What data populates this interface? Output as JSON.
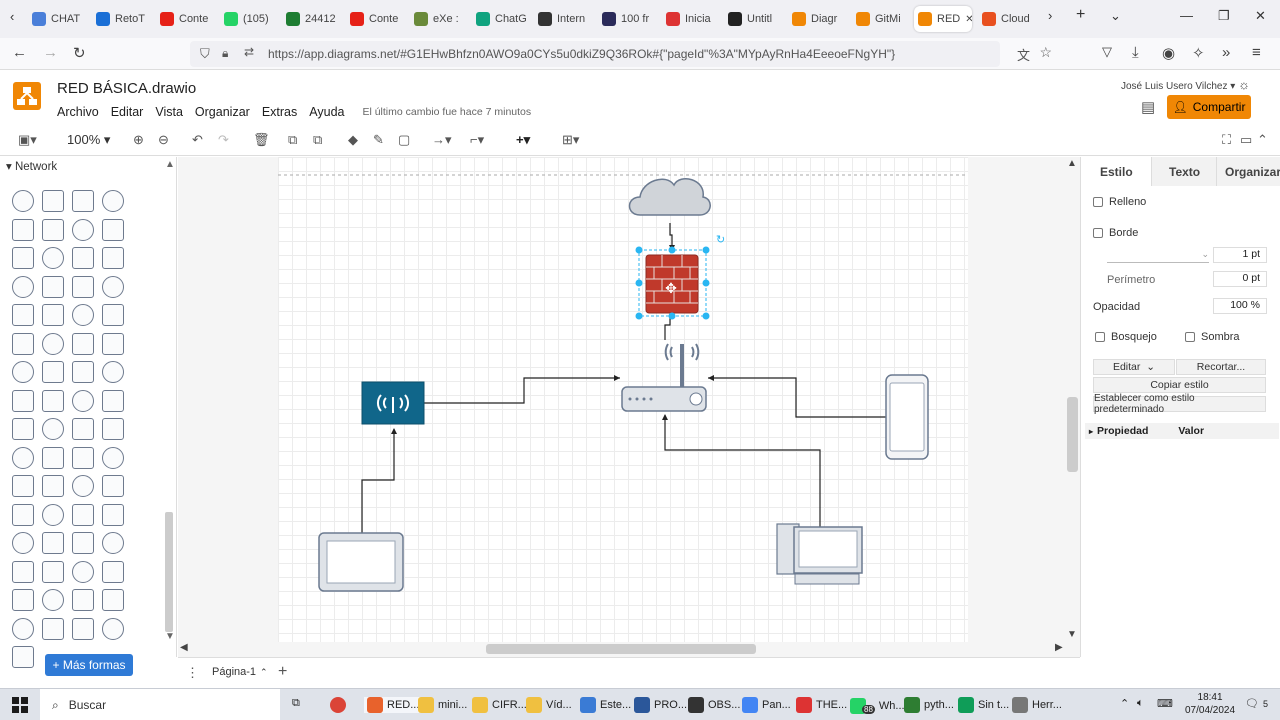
{
  "browser": {
    "tabs": [
      {
        "label": "CHAT",
        "color": "#4a7fd9"
      },
      {
        "label": "RetoT",
        "color": "#1a6fd6"
      },
      {
        "label": "Conte",
        "color": "#e62117"
      },
      {
        "label": "(105)",
        "color": "#25d366"
      },
      {
        "label": "24412",
        "color": "#1e7d32"
      },
      {
        "label": "Conte",
        "color": "#e62117"
      },
      {
        "label": "eXe :",
        "color": "#6a8a3a"
      },
      {
        "label": "ChatG",
        "color": "#10a37f"
      },
      {
        "label": "Intern",
        "color": "#333333"
      },
      {
        "label": "100 fr",
        "color": "#2b2b5a"
      },
      {
        "label": "Inicia",
        "color": "#d33"
      },
      {
        "label": "Untitl",
        "color": "#222222"
      },
      {
        "label": "Diagr",
        "color": "#f08705"
      },
      {
        "label": "GitMi",
        "color": "#f08705"
      },
      {
        "label": "RED",
        "color": "#f08705"
      },
      {
        "label": "Cloud",
        "color": "#e8501f"
      }
    ],
    "url": "https://app.diagrams.net/#G1EHwBhfzn0AWO9a0CYs5u0dkiZ9Q36ROk#{\"pageId\"%3A\"MYpAyRnHa4EeeoeFNgYH\"}"
  },
  "app": {
    "title": "RED BÁSICA.drawio",
    "menus": [
      "Archivo",
      "Editar",
      "Vista",
      "Organizar",
      "Extras",
      "Ayuda"
    ],
    "last_change": "El último cambio fue hace 7 minutos",
    "user": "José Luis Usero Vilchez",
    "share_label": "Compartir",
    "zoom": "100%"
  },
  "left_panel": {
    "section": "Network",
    "more_shapes": "+ Más formas"
  },
  "right_panel": {
    "tabs": [
      "Estilo",
      "Texto",
      "Organizar"
    ],
    "fill": "Relleno",
    "border": "Borde",
    "border_width": "1 pt",
    "perimeter": "Perímetro",
    "perimeter_value": "0 pt",
    "opacity": "Opacidad",
    "opacity_value": "100 %",
    "sketch": "Bosquejo",
    "shadow": "Sombra",
    "edit": "Editar",
    "crop": "Recortar...",
    "copy_style": "Copiar estilo",
    "set_default": "Establecer como estilo predeterminado",
    "prop_header": "Propiedad",
    "value_header": "Valor"
  },
  "page_tab": "Página-1",
  "taskbar": {
    "search": "Buscar",
    "apps": [
      "RED...",
      "mini...",
      "CIFR...",
      "Víd...",
      "Este...",
      "PRO...",
      "OBS...",
      "Pan...",
      "THE...",
      "Wh...",
      "pyth...",
      "Sin t...",
      "Herr..."
    ],
    "whatsapp_badge": "88",
    "time": "18:41",
    "date": "07/04/2024",
    "notif": "5"
  }
}
